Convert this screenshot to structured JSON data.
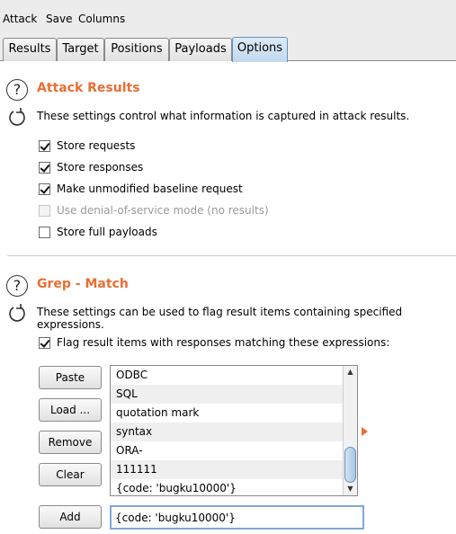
{
  "menu": [
    "Attack",
    "Save",
    "Columns"
  ],
  "tabs": [
    "Results",
    "Target",
    "Positions",
    "Payloads",
    "Options"
  ],
  "active_tab": "Options",
  "attack_results": {
    "title": "Attack Results",
    "description": "These settings control what information is captured in attack results.",
    "options": [
      {
        "label": "Store requests",
        "checked": true,
        "enabled": true
      },
      {
        "label": "Store responses",
        "checked": true,
        "enabled": true
      },
      {
        "label": "Make unmodified baseline request",
        "checked": true,
        "enabled": true
      },
      {
        "label": "Use denial-of-service mode (no results)",
        "checked": false,
        "enabled": false
      },
      {
        "label": "Store full payloads",
        "checked": false,
        "enabled": true
      }
    ]
  },
  "grep_match": {
    "title": "Grep - Match",
    "description": "These settings can be used to flag result items containing specified expressions.",
    "flag_option": {
      "label": "Flag result items with responses matching these expressions:",
      "checked": true
    },
    "buttons": {
      "paste": "Paste",
      "load": "Load ...",
      "remove": "Remove",
      "clear": "Clear",
      "add": "Add"
    },
    "expressions": [
      "ODBC",
      "SQL",
      "quotation mark",
      "syntax",
      "ORA-",
      "111111",
      "{code: 'bugku10000'}"
    ],
    "add_input_value": "{code: 'bugku10000'}"
  },
  "icons": {
    "help": "help-circle-icon",
    "refresh": "refresh-icon"
  },
  "colors": {
    "section_title": "#e86f34",
    "active_tab": "#c2d9ee"
  }
}
